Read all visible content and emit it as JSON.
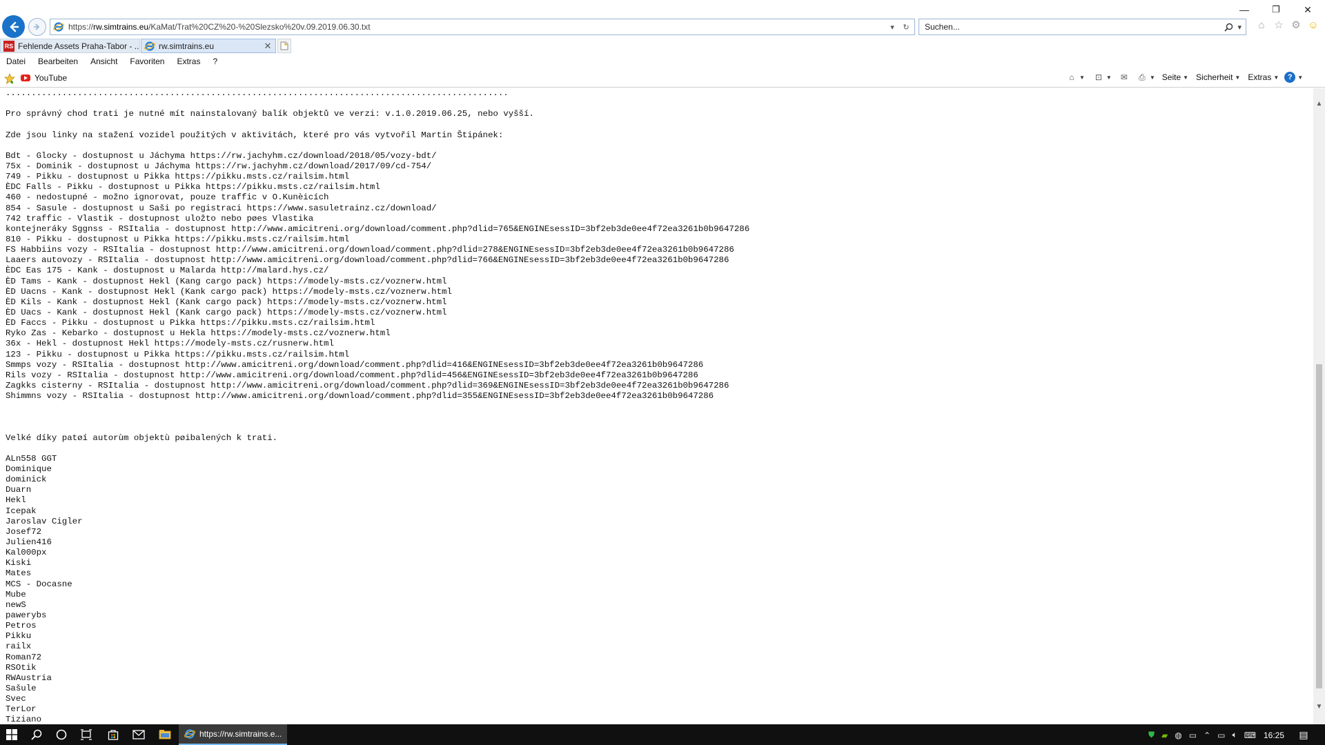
{
  "window": {
    "controls": {
      "minimize": "—",
      "restore": "❐",
      "close": "✕"
    }
  },
  "browser": {
    "address": {
      "prefix": "https://",
      "host": "rw.simtrains.eu",
      "path": "/KaMat/Trat%20CZ%20-%20Slezsko%20v.09.2019.06.30.txt"
    },
    "search": {
      "placeholder": "Suchen..."
    },
    "tabs": [
      {
        "label": "Fehlende Assets Praha-Tabor - ...",
        "favicon": "RS",
        "active": false
      },
      {
        "label": "rw.simtrains.eu",
        "favicon": "ie-icon",
        "active": true
      }
    ],
    "menu": [
      "Datei",
      "Bearbeiten",
      "Ansicht",
      "Favoriten",
      "Extras",
      "?"
    ],
    "favorites": {
      "youtube_label": "YouTube"
    },
    "command_bar": {
      "page_label": "Seite",
      "security_label": "Sicherheit",
      "extras_label": "Extras"
    }
  },
  "document": {
    "lines": [
      "..................................................................................................",
      "",
      "Pro správný chod trati je nutné mít nainstalovaný balík objektů ve verzi: v.1.0.2019.06.25, nebo vyšší.",
      "",
      "Zde jsou linky na stažení vozidel použitých v aktivitách, které pro vás vytvořil Martin Štipánek:",
      "",
      "Bdt - Glocky - dostupnost u Jáchyma https://rw.jachyhm.cz/download/2018/05/vozy-bdt/",
      "75x - Dominik - dostupnost u Jáchyma https://rw.jachyhm.cz/download/2017/09/cd-754/",
      "749 - Pikku - dostupnost u Pikka https://pikku.msts.cz/railsim.html",
      "ÈDC Falls - Pikku - dostupnost u Pikka https://pikku.msts.cz/railsim.html",
      "460 - nedostupné - možno ignorovat, pouze traffic v O.Kunèicích",
      "854 - Sasule - dostupnost u Saši po registraci https://www.sasuletrainz.cz/download/",
      "742 traffic - Vlastik - dostupnost uložto nebo pøes Vlastika",
      "kontejneráky Sggnss - RSItalia - dostupnost http://www.amicitreni.org/download/comment.php?dlid=765&ENGINEsessID=3bf2eb3de0ee4f72ea3261b0b9647286",
      "810 - Pikku - dostupnost u Pikka https://pikku.msts.cz/railsim.html",
      "FS Habbiins vozy - RSItalia - dostupnost http://www.amicitreni.org/download/comment.php?dlid=278&ENGINEsessID=3bf2eb3de0ee4f72ea3261b0b9647286",
      "Laaers autovozy - RSItalia - dostupnost http://www.amicitreni.org/download/comment.php?dlid=766&ENGINEsessID=3bf2eb3de0ee4f72ea3261b0b9647286",
      "ÈDC Eas 175 - Kank - dostupnost u Malarda http://malard.hys.cz/",
      "ÈD Tams - Kank - dostupnost Hekl (Kang cargo pack) https://modely-msts.cz/voznerw.html",
      "ÈD Uacns - Kank - dostupnost Hekl (Kank cargo pack) https://modely-msts.cz/voznerw.html",
      "ÈD Kils - Kank - dostupnost Hekl (Kank cargo pack) https://modely-msts.cz/voznerw.html",
      "ÈD Uacs - Kank - dostupnost Hekl (Kank cargo pack) https://modely-msts.cz/voznerw.html",
      "ÈD Faccs - Pikku - dostupnost u Pikka https://pikku.msts.cz/railsim.html",
      "Ryko Zas - Kebarko - dostupnost u Hekla https://modely-msts.cz/voznerw.html",
      "36x - Hekl - dostupnost Hekl https://modely-msts.cz/rusnerw.html",
      "123 - Pikku - dostupnost u Pikka https://pikku.msts.cz/railsim.html",
      "Smmps vozy - RSItalia - dostupnost http://www.amicitreni.org/download/comment.php?dlid=416&ENGINEsessID=3bf2eb3de0ee4f72ea3261b0b9647286",
      "Rils vozy - RSItalia - dostupnost http://www.amicitreni.org/download/comment.php?dlid=456&ENGINEsessID=3bf2eb3de0ee4f72ea3261b0b9647286",
      "Zagkks cisterny - RSItalia - dostupnost http://www.amicitreni.org/download/comment.php?dlid=369&ENGINEsessID=3bf2eb3de0ee4f72ea3261b0b9647286",
      "Shimmns vozy - RSItalia - dostupnost http://www.amicitreni.org/download/comment.php?dlid=355&ENGINEsessID=3bf2eb3de0ee4f72ea3261b0b9647286",
      "",
      "",
      "",
      "Velké díky patøí autorùm objektù pøibalených k trati.",
      "",
      "ALn558 GGT",
      "Dominique",
      "dominick",
      "Duarn",
      "Hekl",
      "Icepak",
      "Jaroslav Cigler",
      "Josef72",
      "Julien416",
      "Kal000px",
      "Kiski",
      "Mates",
      "MCS - Docasne",
      "Mube",
      "newS",
      "pawerybs",
      "Petros",
      "Pikku",
      "railx",
      "Roman72",
      "RSOtik",
      "RWAustria",
      "Sašule",
      "Svec",
      "TerLor",
      "Tiziano"
    ]
  },
  "taskbar": {
    "active_app_label": "https://rw.simtrains.e...",
    "clock": "16:25"
  }
}
